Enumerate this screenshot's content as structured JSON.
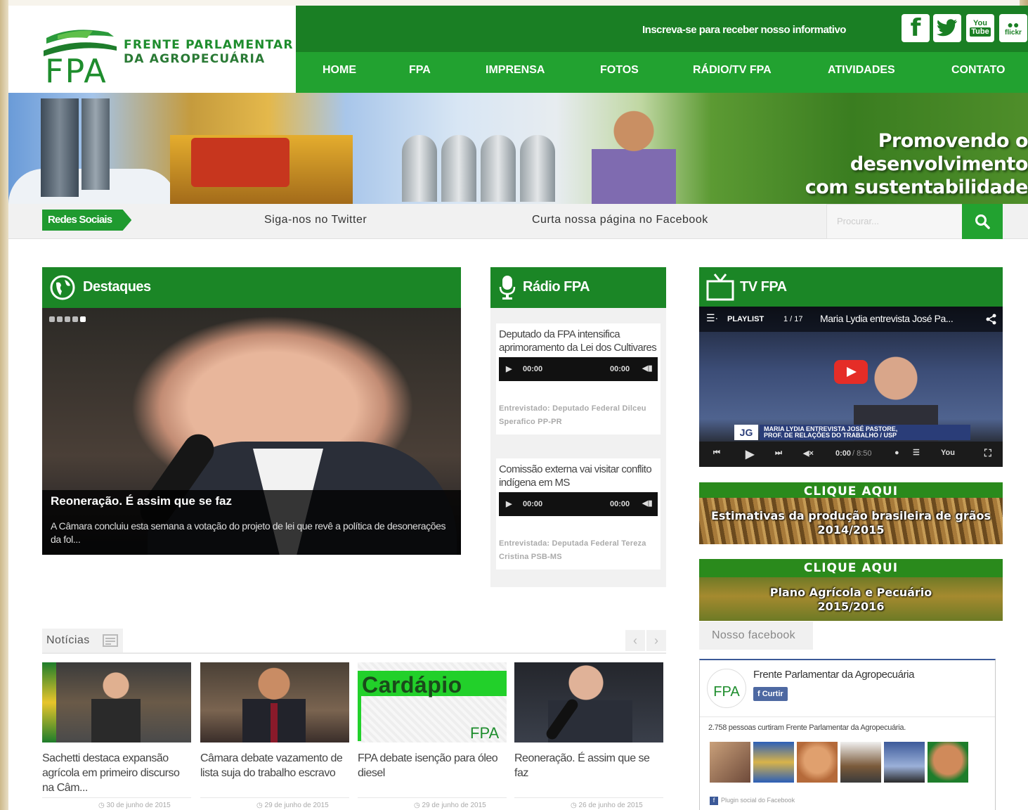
{
  "brand": {
    "acronym": "FPA",
    "line1": "FRENTE PARLAMENTAR",
    "line2": "DA AGROPECUÁRIA",
    "green": "#1b8626",
    "light_green": "#22a230"
  },
  "topbar": {
    "newsletter": "Inscreva-se para receber nosso informativo",
    "social_icons": [
      "facebook-icon",
      "twitter-icon",
      "youtube-icon",
      "flickr-icon"
    ],
    "social_labels": {
      "facebook": "f",
      "youtube_top": "You",
      "youtube_bottom": "Tube",
      "flickr": "flickr"
    }
  },
  "nav": {
    "items": [
      "HOME",
      "FPA",
      "IMPRENSA",
      "FOTOS",
      "RÁDIO/TV FPA",
      "ATIVIDADES",
      "CONTATO"
    ]
  },
  "banner": {
    "slogan_line1": "Promovendo o desenvolvimento",
    "slogan_line2": "com sustentabilidade"
  },
  "strip": {
    "redes": "Redes Sociais",
    "twitter": "Siga-nos no Twitter",
    "facebook": "Curta nossa página no Facebook",
    "search_placeholder": "Procurar..."
  },
  "destaques": {
    "heading": "Destaques",
    "title": "Reoneração. É assim que se faz",
    "excerpt": "A Câmara concluiu esta semana a votação do projeto de lei que revê a política de desonerações da fol..."
  },
  "radio": {
    "heading": "Rádio FPA",
    "items": [
      {
        "title": "Deputado da FPA intensifica aprimoramento da Lei dos Cultivares",
        "time_current": "00:00",
        "time_total": "00:00",
        "meta": "Entrevistado: Deputado Federal Dilceu Sperafico PP-PR"
      },
      {
        "title": "Comissão externa vai visitar conflito indígena em MS",
        "time_current": "00:00",
        "time_total": "00:00",
        "meta": "Entrevistada: Deputada Federal Tereza Cristina PSB-MS"
      }
    ]
  },
  "tv": {
    "heading": "TV FPA",
    "playlist_label": "PLAYLIST",
    "playlist_count": "1 / 17",
    "video_title": "Maria Lydia entrevista José Pa...",
    "lower_third_line1": "MARIA LYDIA ENTREVISTA JOSÉ PASTORE,",
    "lower_third_line2": "PROF. DE RELAÇÕES DO TRABALHO / USP",
    "time": "0:00",
    "duration": "/ 8:50",
    "channel_logo": "JG",
    "youtube_logo": "You"
  },
  "promos": [
    {
      "cta": "CLIQUE AQUI",
      "line1": "Estimativas da produção brasileira de grãos",
      "line2": "2014/2015"
    },
    {
      "cta": "CLIQUE AQUI",
      "line1": "Plano Agrícola e Pecuário",
      "line2": "2015/2016"
    }
  ],
  "facebook": {
    "tab": "Nosso facebook",
    "page_name": "Frente Parlamentar da Agropecuária",
    "like_label": "Curtir",
    "like_count_text": "2.758 pessoas curtiram Frente Parlamentar da Agropecuária.",
    "plugin_text": "Plugin social do Facebook"
  },
  "news": {
    "heading": "Notícias",
    "prev": "‹",
    "next": "›",
    "items": [
      {
        "title": "Sachetti destaca expansão agrícola em primeiro discurso na Câm...",
        "date": "30 de junho de 2015"
      },
      {
        "title": "Câmara debate vazamento de lista suja do trabalho escravo",
        "date": "29 de junho de 2015"
      },
      {
        "title": "FPA debate isenção para óleo diesel",
        "date": "29 de junho de 2015",
        "thumb_text": "Cardápio"
      },
      {
        "title": "Reoneração. É assim que se faz",
        "date": "26 de junho de 2015"
      }
    ]
  }
}
